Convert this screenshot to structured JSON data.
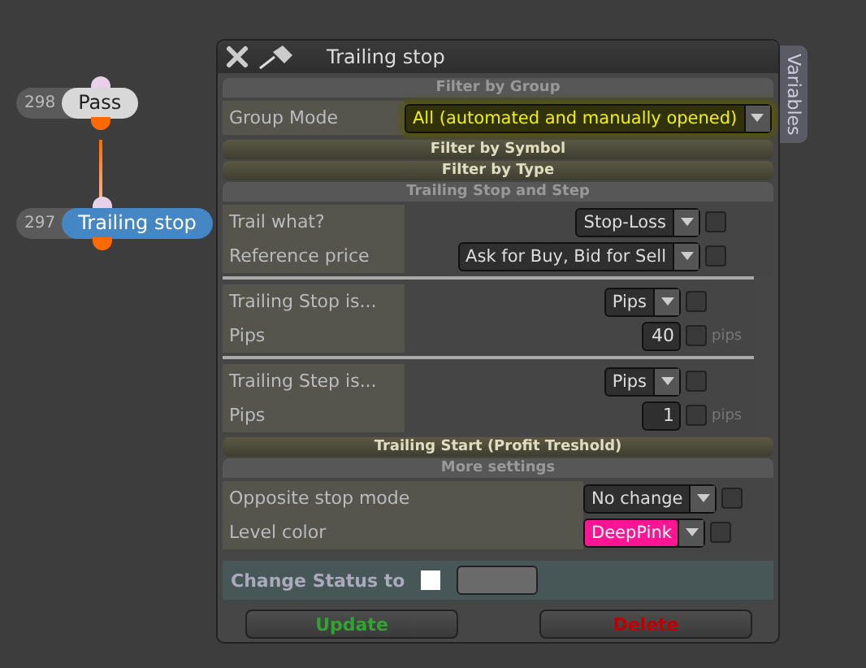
{
  "nodes": [
    {
      "number": "298",
      "label": "Pass",
      "selected": false
    },
    {
      "number": "297",
      "label": "Trailing stop",
      "selected": true
    }
  ],
  "panel": {
    "title": "Trailing stop",
    "side_tab": "Variables",
    "sections": [
      {
        "header": "Filter by Group",
        "expanded": true,
        "groups": [
          [
            {
              "label": "Group Mode",
              "kind": "dropdown",
              "value": "All (automated and manually opened)",
              "highlighted": true
            }
          ]
        ]
      },
      {
        "header": "Filter by Symbol",
        "expanded": false
      },
      {
        "header": "Filter by Type",
        "expanded": false
      },
      {
        "header": "Trailing Stop and Step",
        "expanded": true,
        "groups": [
          [
            {
              "label": "Trail what?",
              "kind": "dropdown",
              "value": "Stop-Loss",
              "highlighted": false,
              "checked": false
            },
            {
              "label": "Reference price",
              "kind": "dropdown",
              "value": "Ask for Buy, Bid for Sell",
              "highlighted": false,
              "checked": false
            }
          ],
          [
            {
              "label": "Trailing Stop is...",
              "kind": "dropdown",
              "value": "Pips",
              "highlighted": false,
              "checked": false
            },
            {
              "label": "Pips",
              "kind": "number",
              "value": "40",
              "checked": false,
              "unit": "pips"
            }
          ],
          [
            {
              "label": "Trailing Step is...",
              "kind": "dropdown",
              "value": "Pips",
              "highlighted": false,
              "checked": false
            },
            {
              "label": "Pips",
              "kind": "number",
              "value": "1",
              "checked": false,
              "unit": "pips"
            }
          ]
        ]
      },
      {
        "header": "Trailing Start (Profit Treshold)",
        "expanded": false
      },
      {
        "header": "More settings",
        "expanded": true,
        "groups": [
          [
            {
              "label": "Opposite stop mode",
              "kind": "dropdown",
              "value": "No change",
              "highlighted": false,
              "checked": false
            },
            {
              "label": "Level color",
              "kind": "dropdown",
              "value": "DeepPink",
              "highlighted": false,
              "checked": false,
              "color": "#ff1493"
            }
          ]
        ]
      }
    ],
    "status": {
      "label": "Change Status to",
      "color": "#ffffff"
    },
    "buttons": [
      {
        "label": "Update",
        "kind": "confirm"
      },
      {
        "label": "Delete",
        "kind": "danger"
      }
    ]
  }
}
